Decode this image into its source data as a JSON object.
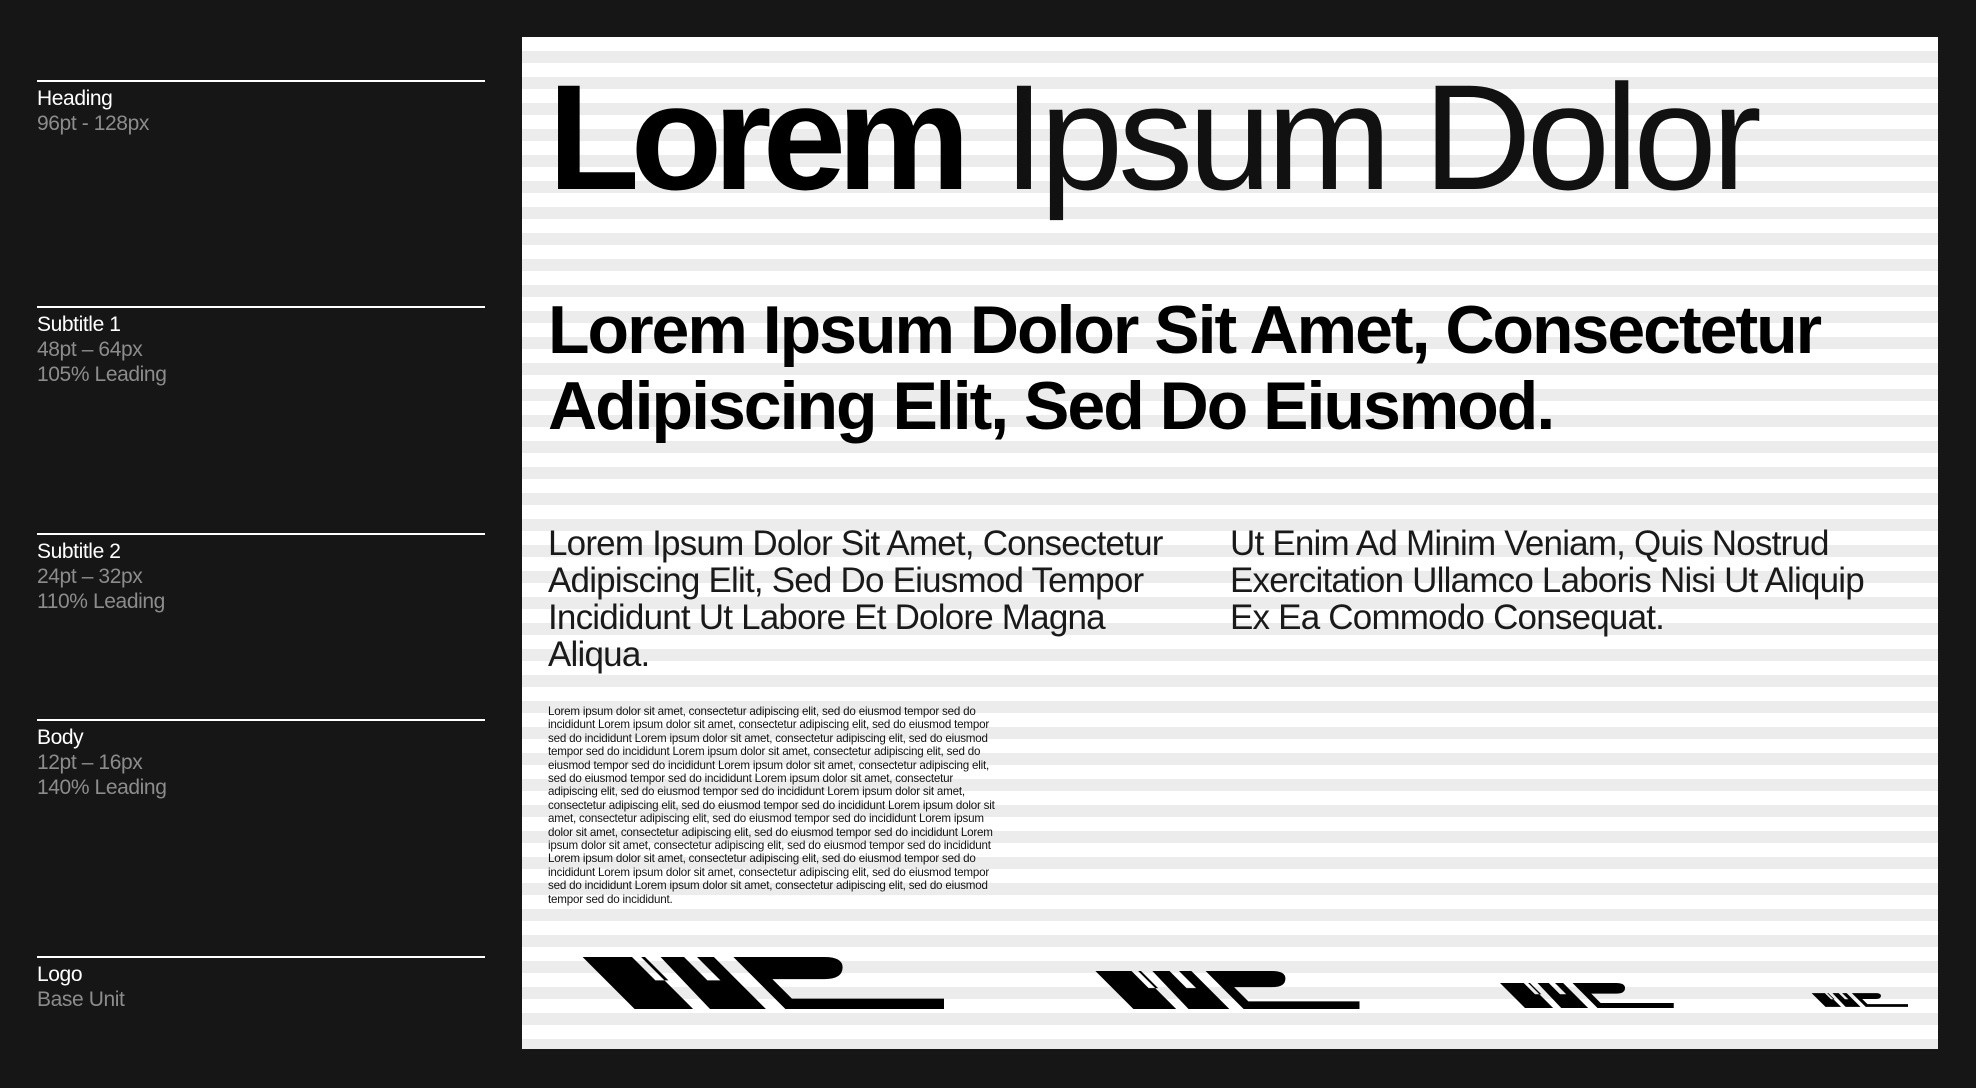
{
  "specs": [
    {
      "name": "Heading",
      "details": [
        "96pt - 128px"
      ]
    },
    {
      "name": "Subtitle 1",
      "details": [
        "48pt – 64px",
        "105% Leading"
      ]
    },
    {
      "name": "Subtitle 2",
      "details": [
        "24pt – 32px",
        "110% Leading"
      ]
    },
    {
      "name": "Body",
      "details": [
        "12pt – 16px",
        "140% Leading"
      ]
    },
    {
      "name": "Logo",
      "details": [
        "Base Unit"
      ]
    }
  ],
  "specimen": {
    "heading_bold": "Lorem",
    "heading_light": "Ipsum Dolor",
    "subtitle1": "Lorem Ipsum Dolor Sit Amet, Consectetur Adipiscing Elit, Sed Do Eiusmod.",
    "subtitle2_left": "Lorem Ipsum Dolor Sit Amet, Consectetur Adipiscing Elit, Sed Do Eiusmod Tempor Incididunt Ut Labore Et Dolore Magna Aliqua.",
    "subtitle2_right": "Ut Enim Ad Minim Veniam, Quis Nostrud Exercitation Ullamco Laboris Nisi Ut Aliquip Ex Ea Commodo Consequat.",
    "body": "Lorem ipsum dolor sit amet, consectetur adipiscing elit, sed do eiusmod  tempor sed do incididunt Lorem ipsum dolor sit amet, consectetur adipiscing elit, sed do eiusmod  tempor sed do incididunt Lorem ipsum dolor sit amet, consectetur adipiscing elit, sed do eiusmod  tempor sed do incididunt Lorem ipsum dolor sit amet, consectetur adipiscing elit, sed do eiusmod  tempor sed do incididunt Lorem ipsum dolor sit amet, consectetur adipiscing elit, sed do eiusmod  tempor sed do incididunt Lorem ipsum dolor sit amet, consectetur adipiscing elit, sed do eiusmod  tempor sed do incididunt Lorem ipsum dolor sit amet, consectetur adipiscing elit, sed do eiusmod  tempor sed do incididunt Lorem ipsum dolor sit amet, consectetur adipiscing elit, sed do eiusmod  tempor sed do incididunt Lorem ipsum dolor sit amet, consectetur adipiscing elit, sed do eiusmod  tempor sed do incididunt Lorem ipsum dolor sit amet, consectetur adipiscing elit, sed do eiusmod  tempor sed do incididunt Lorem ipsum dolor sit amet, consectetur adipiscing elit, sed do eiusmod  tempor sed do incididunt Lorem ipsum dolor sit amet, consectetur adipiscing elit, sed do eiusmod  tempor sed do incididunt Lorem ipsum dolor sit amet, consectetur adipiscing elit, sed do eiusmod  tempor sed do incididunt.",
    "logo_icon": "wpa-logo-icon"
  },
  "colors": {
    "background": "#161616",
    "card": "#ffffff",
    "stripe": "#ececec",
    "spec_label": "#ffffff",
    "spec_detail": "#8c8c8c",
    "ink": "#000000"
  }
}
